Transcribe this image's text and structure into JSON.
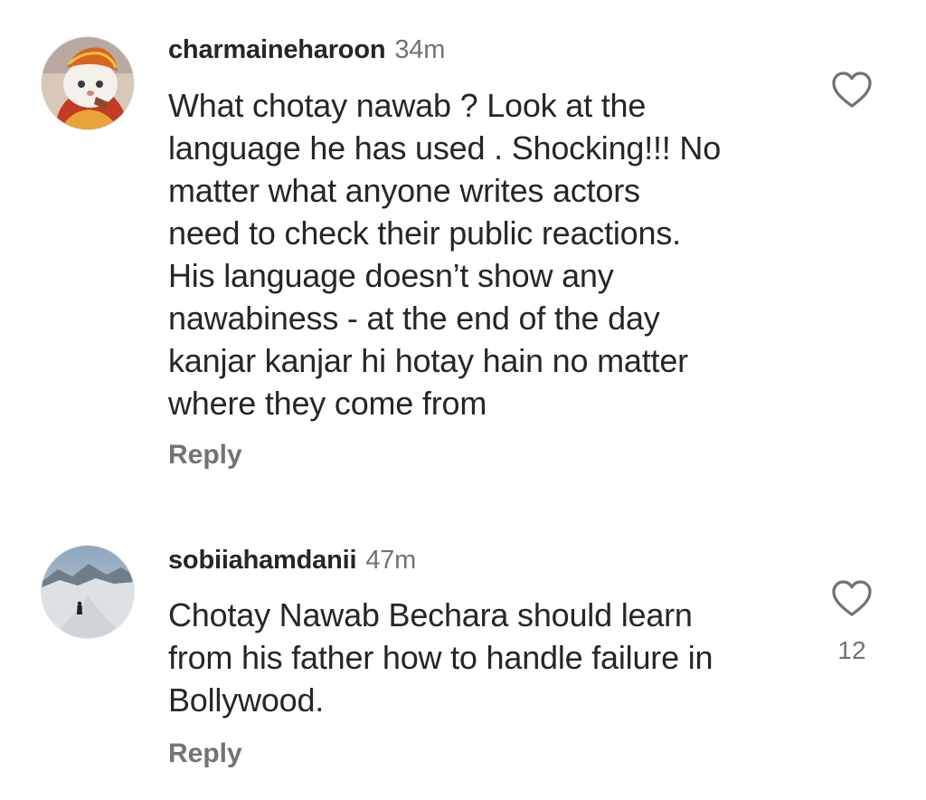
{
  "comments": [
    {
      "username": "charmaineharoon",
      "time": "34m",
      "text": "What chotay nawab ? Look at the\nlanguage he has used . Shocking!!! No\nmatter what anyone writes actors\nneed to check their public reactions.\nHis language doesn’t show any\nnawabiness - at the end of the day\nkanjar kanjar hi hotay hain no matter\nwhere they come from",
      "reply_label": "Reply",
      "like_icon": "heart-outline-icon",
      "like_count": ""
    },
    {
      "username": "sobiiahamdanii",
      "time": "47m",
      "text": "Chotay Nawab Bechara should learn\nfrom his father how to handle failure in\nBollywood.",
      "reply_label": "Reply",
      "like_icon": "heart-outline-icon",
      "like_count": "12"
    }
  ],
  "colors": {
    "text": "#262626",
    "secondary": "#737373",
    "background": "#ffffff"
  }
}
